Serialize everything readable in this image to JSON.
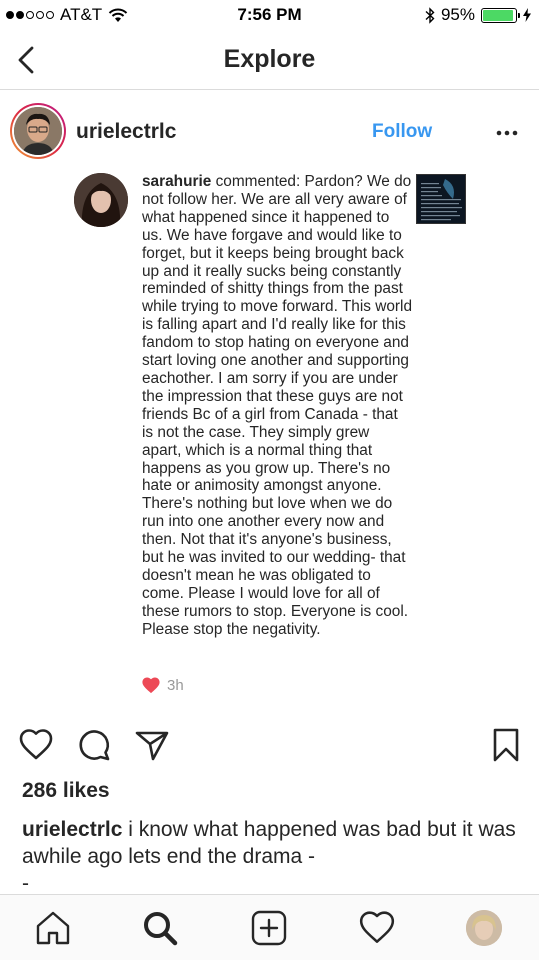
{
  "status_bar": {
    "carrier": "AT&T",
    "time": "7:56 PM",
    "battery": "95%",
    "battery_level": 0.95
  },
  "nav": {
    "title": "Explore"
  },
  "post": {
    "username": "urielectrlc",
    "follow_label": "Follow",
    "photo": {
      "commenter": "sarahurie",
      "comment_text": " commented: Pardon? We do not follow her. We are all very aware of what happened since it happened to us. We have forgave and would like to forget, but it keeps being brought back up and it really sucks being constantly reminded of shitty things from the past while trying to move forward. This world is falling apart and I'd really like for this fandom to stop hating on everyone and start loving one another and supporting eachother. I am sorry if you are under the impression that these guys are not friends Bc of a girl from Canada - that is not the case. They simply grew apart, which is a normal thing that happens as you grow up. There's no hate or animosity amongst anyone. There's nothing but love when we do run into one another every now and then. Not that it's anyone's business, but he was invited to our wedding- that doesn't mean he was obligated to come. Please I would love for all of these rumors to stop. Everyone is cool. Please stop the negativity.",
      "comment_time": "3h"
    },
    "likes": "286 likes",
    "caption_user": "urielectrlc",
    "caption_text": " i know what happened was bad but it was awhile ago lets end the drama -\n-"
  },
  "colors": {
    "link_blue": "#3897f0",
    "heart_red": "#ed4956",
    "battery_green": "#4cd964"
  },
  "icons": {
    "nav": [
      "back-chevron-icon"
    ],
    "actions": [
      "heart-outline-icon",
      "comment-bubble-icon",
      "share-send-icon",
      "bookmark-icon"
    ],
    "tabs": [
      "home-icon",
      "search-icon",
      "add-post-icon",
      "activity-heart-icon",
      "profile-avatar"
    ]
  }
}
